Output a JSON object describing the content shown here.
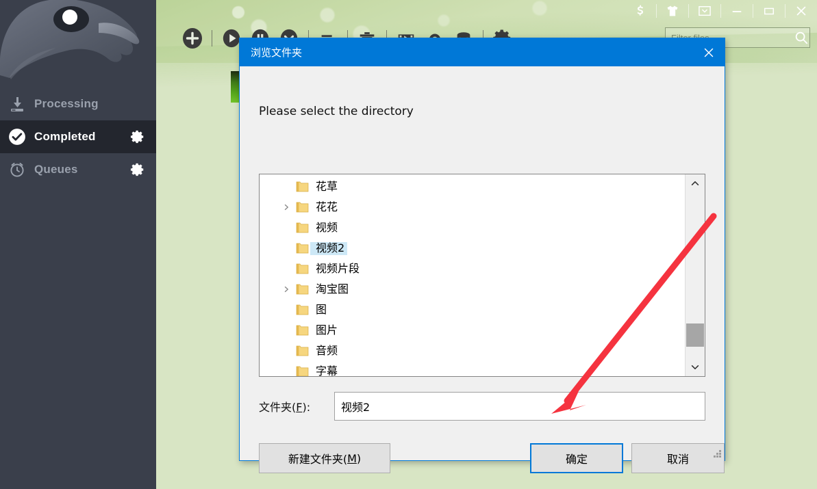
{
  "app": {
    "titlebar_buttons": [
      {
        "name": "donate-button",
        "icon": "dollar-icon",
        "glyph": "$"
      },
      {
        "name": "skins-button",
        "icon": "shirt-icon",
        "glyph": "shirt"
      },
      {
        "name": "tray-button",
        "icon": "tray-down-icon",
        "glyph": "tray"
      },
      {
        "name": "minimize-button",
        "icon": "minimize-icon",
        "glyph": "minimize"
      },
      {
        "name": "maximize-button",
        "icon": "maximize-icon",
        "glyph": "maximize"
      },
      {
        "name": "close-button",
        "icon": "close-icon",
        "glyph": "close"
      }
    ],
    "toolbar_buttons": [
      {
        "name": "add-download-button",
        "icon": "plus-circle-icon"
      },
      {
        "name": "start-button",
        "icon": "play-icon"
      },
      {
        "name": "pause-button",
        "icon": "pause-icon"
      },
      {
        "name": "stop-button",
        "icon": "stop-down-icon"
      },
      {
        "name": "queue-order-button",
        "icon": "list-icon"
      },
      {
        "name": "delete-button",
        "icon": "trash-icon"
      },
      {
        "name": "video-button",
        "icon": "film-icon"
      },
      {
        "name": "upload-button",
        "icon": "arch-icon"
      },
      {
        "name": "storage-button",
        "icon": "database-icon"
      },
      {
        "name": "settings-button",
        "icon": "gear-icon"
      }
    ],
    "search": {
      "placeholder": "Filter files...",
      "value": "",
      "icon": "search-icon"
    },
    "sidebar": {
      "logo": "eagle-head-logo",
      "items": [
        {
          "label": "Processing",
          "icon": "download-icon",
          "active": false,
          "has_gear": false
        },
        {
          "label": "Completed",
          "icon": "check-circle-icon",
          "active": true,
          "has_gear": true
        },
        {
          "label": "Queues",
          "icon": "clock-icon",
          "active": false,
          "has_gear": true
        }
      ]
    }
  },
  "dialog": {
    "title": "浏览文件夹",
    "close_icon": "close-icon",
    "prompt": "Please select the directory",
    "tree": {
      "items": [
        {
          "label": "花草",
          "expandable": false,
          "selected": false
        },
        {
          "label": "花花",
          "expandable": true,
          "selected": false
        },
        {
          "label": "视频",
          "expandable": false,
          "selected": false
        },
        {
          "label": "视频2",
          "expandable": false,
          "selected": true
        },
        {
          "label": "视频片段",
          "expandable": false,
          "selected": false
        },
        {
          "label": "淘宝图",
          "expandable": true,
          "selected": false
        },
        {
          "label": "图",
          "expandable": false,
          "selected": false
        },
        {
          "label": "图片",
          "expandable": false,
          "selected": false
        },
        {
          "label": "音频",
          "expandable": false,
          "selected": false
        },
        {
          "label": "字幕",
          "expandable": false,
          "selected": false
        }
      ],
      "scroll_up_icon": "chevron-up-icon",
      "scroll_down_icon": "chevron-down-icon"
    },
    "folder_field": {
      "label_text": "文件夹(",
      "label_key": "F",
      "label_tail": "):",
      "value": "视频2"
    },
    "buttons": {
      "new_folder_text": "新建文件夹(",
      "new_folder_key": "M",
      "new_folder_tail": ")",
      "ok": "确定",
      "cancel": "取消"
    },
    "resize_grip": "resize-grip-icon"
  },
  "annotation": {
    "arrow_color": "#f5333f",
    "points_to": "确定"
  },
  "colors": {
    "dialog_accent": "#0078d7",
    "selection": "#cde8f6",
    "sidebar_bg": "#3a3f4b",
    "sidebar_active_bg": "#23262e",
    "window_bg": "#d8e5c4"
  }
}
